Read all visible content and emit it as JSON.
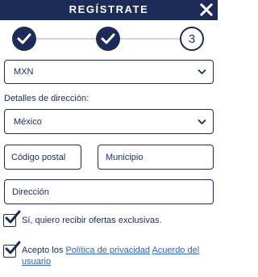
{
  "header": {
    "title": "REGÍSTRATE",
    "close_icon": "close-icon"
  },
  "stepper": {
    "steps": [
      {
        "state": "completed",
        "icon": "checkmark-icon"
      },
      {
        "state": "completed",
        "icon": "checkmark-icon"
      },
      {
        "state": "current",
        "label": "3"
      }
    ]
  },
  "form": {
    "currency": {
      "value": "MXN",
      "icon": "chevron-down-icon"
    },
    "address_section_label": "Detalles de dirección:",
    "country": {
      "value": "México",
      "icon": "chevron-down-icon"
    },
    "postal_code": {
      "placeholder": "Código postal"
    },
    "municipality": {
      "placeholder": "Municipio"
    },
    "address": {
      "placeholder": "Dirección"
    }
  },
  "consents": {
    "offers": {
      "checked": true,
      "label": "Sí, quiero recibir ofertas exclusivas."
    },
    "terms": {
      "checked": true,
      "prefix": "Acepto los",
      "privacy_link": "Política de privacidad",
      "agreement_link_line1": "Acuerdo del",
      "agreement_link_line2": "usuario"
    }
  },
  "colors": {
    "primary": "#1c2b57",
    "link": "#2d63b8",
    "step_line": "#cfd3dc"
  }
}
